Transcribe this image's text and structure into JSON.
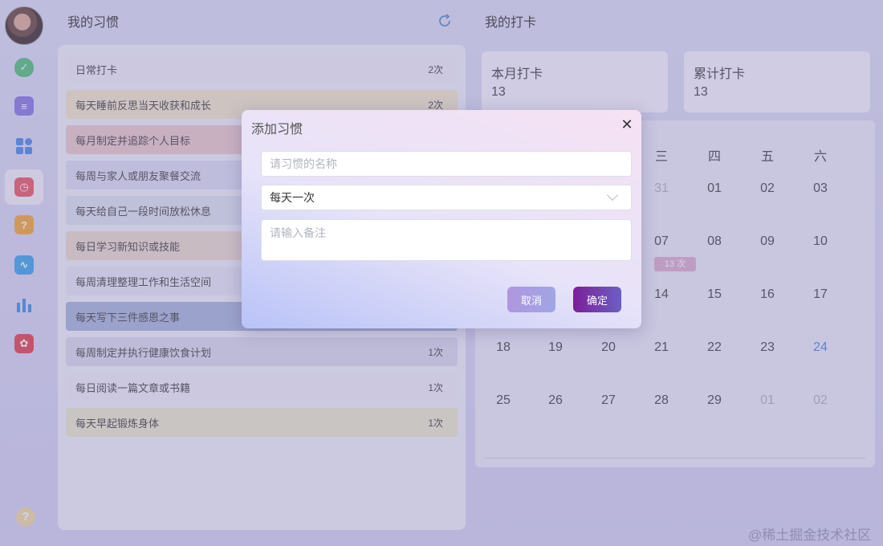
{
  "habits": {
    "title": "我的习惯",
    "items": [
      {
        "label": "日常打卡",
        "count": "2次",
        "color": "#eceef6"
      },
      {
        "label": "每天睡前反思当天收获和成长",
        "count": "2次",
        "color": "#efe7c3"
      },
      {
        "label": "每月制定并追踪个人目标",
        "count": "",
        "color": "#e8c7c3"
      },
      {
        "label": "每周与家人或朋友聚餐交流",
        "count": "",
        "color": "#d9dcef"
      },
      {
        "label": "每天给自己一段时间放松休息",
        "count": "",
        "color": "#d7e3ea"
      },
      {
        "label": "每日学习新知识或技能",
        "count": "",
        "color": "#e8d9c6"
      },
      {
        "label": "每周清理整理工作和生活空间",
        "count": "",
        "color": "#e3e5f0"
      },
      {
        "label": "每天写下三件感恩之事",
        "count": "",
        "color": "#9eb0d4"
      },
      {
        "label": "每周制定并执行健康饮食计划",
        "count": "1次",
        "color": "#d7d8ea"
      },
      {
        "label": "每日阅读一篇文章或书籍",
        "count": "1次",
        "color": "#eceef6"
      },
      {
        "label": "每天早起锻炼身体",
        "count": "1次",
        "color": "#e8e9c6"
      }
    ]
  },
  "checkin": {
    "title": "我的打卡",
    "month_label": "本月打卡",
    "month_value": "13",
    "total_label": "累计打卡",
    "total_value": "13",
    "weekdays": [
      "三",
      "四",
      "五",
      "六"
    ],
    "badge": "13 次",
    "rows": [
      [
        "31",
        "01",
        "02",
        "03"
      ],
      [
        "07",
        "08",
        "09",
        "10"
      ],
      [
        "14",
        "15",
        "16",
        "17"
      ],
      [
        "18",
        "19",
        "20",
        "21",
        "22",
        "23",
        "24"
      ],
      [
        "25",
        "26",
        "27",
        "28",
        "29",
        "01",
        "02"
      ]
    ]
  },
  "dialog": {
    "title": "添加习惯",
    "name_placeholder": "请习惯的名称",
    "frequency": "每天一次",
    "note_placeholder": "请输入备注",
    "cancel": "取消",
    "ok": "确定"
  },
  "watermark": "@稀土掘金技术社区",
  "colors": {
    "accent": "#7b1f9a",
    "today": "#3b7dd8"
  }
}
